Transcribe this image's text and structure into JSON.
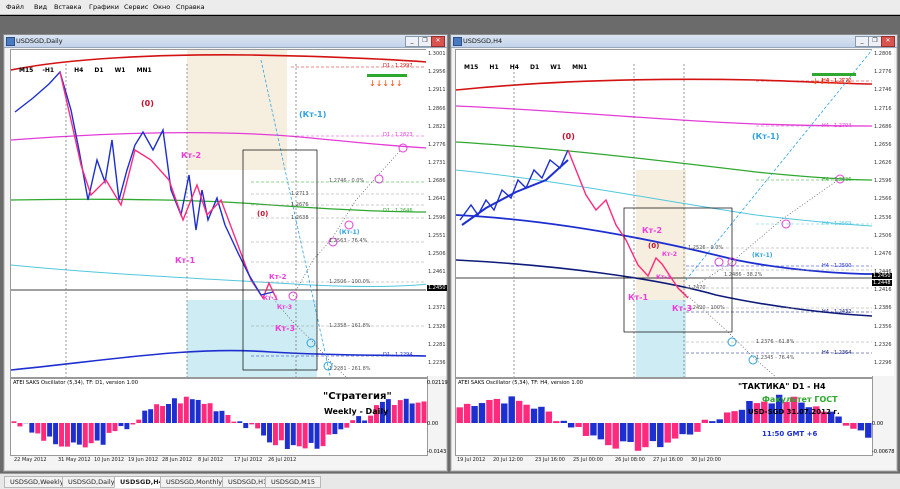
{
  "menu": [
    "Файл",
    "Вид",
    "Вставка",
    "Графики",
    "Сервис",
    "Окно",
    "Справка"
  ],
  "left": {
    "title": "USDSGD,Daily",
    "timeframes": [
      "M15",
      "H1",
      "H4",
      "D1",
      "W1",
      "MN1"
    ],
    "price_scale": [
      "1.3001",
      "1.2956",
      "1.2911",
      "1.2866",
      "1.2821",
      "1.2776",
      "1.2731",
      "1.2686",
      "1.2641",
      "1.2596",
      "1.2551",
      "1.2506",
      "1.2461",
      "1.2416",
      "1.2371",
      "1.2326",
      "1.2281",
      "1.2236"
    ],
    "current_price": "1.2450",
    "top_level": "D1 - 1.2997",
    "level2": "D1 - 1.2823",
    "level3": "D1 - 1.2646",
    "level4": "D1 - 1.2294",
    "fibs": [
      "1.2746 - 0.0%",
      "1.2713",
      "1.2676",
      "1.2638",
      "1.2563 - 76.4%",
      "1.2506 - 100.0%",
      "1.2358 - 161.8%",
      "1.2281 - 261.8%"
    ],
    "labels": {
      "zero": "(0)",
      "kt2": "Кт-2",
      "kt1": "Кт-1",
      "zero2": "(0)",
      "kt1m": "(Кт-1)",
      "kt2b": "Кт-2",
      "kt1b": "Кт-1",
      "kt3": "Кт-3",
      "kt3b": "Кт-3",
      "kt1c": "(Кт-1)"
    },
    "indicator_title": "ATEI SAKS Oscillator (5,34), TF: D1, version 1.00",
    "indicator_scale": [
      "0.02119",
      "0.00",
      "-0.0143"
    ],
    "strategy_title": "\"Стратегия\"",
    "strategy_sub": "Weekly - Daily",
    "xaxis": [
      "22 May 2012",
      "31 May 2012",
      "10 Jun 2012",
      "19 Jun 2012",
      "28 Jun 2012",
      "8 Jul 2012",
      "17 Jul 2012",
      "26 Jul 2012"
    ]
  },
  "right": {
    "title": "USDSGD,H4",
    "timeframes": [
      "M15",
      "H1",
      "H4",
      "D1",
      "W1",
      "MN1"
    ],
    "price_scale": [
      "1.2806",
      "1.2776",
      "1.2746",
      "1.2716",
      "1.2686",
      "1.2656",
      "1.2626",
      "1.2596",
      "1.2566",
      "1.2536",
      "1.2506",
      "1.2476",
      "1.2446",
      "1.2416",
      "1.2386",
      "1.2356",
      "1.2326",
      "1.2296"
    ],
    "current_price": "1.2450",
    "current_price2": "1.2448",
    "top_level": "H4 - 1.2772",
    "level2": "H4 - 1.2704",
    "level3": "H4 - 1.2636",
    "level4": "H4 - 1.2569",
    "level5": "H4 - 1.2500",
    "level6": "H4 - 1.2432",
    "level7": "H4 - 1.2364",
    "fibs": [
      "1.2526 - 0.0%",
      "1.2486 - 38.2%",
      "1.2470",
      "1.2420 - 100%",
      "1.2376 - 61.8%",
      "1.2345 - 76.4%"
    ],
    "labels": {
      "zero": "(0)",
      "kt1m": "(Кт-1)",
      "kt2": "Кт-2",
      "zero2": "(0)",
      "kt2b": "Кт-2",
      "kt1": "Кт-1",
      "kt1b": "Кт-1",
      "kt3": "Кт-3",
      "kt1c": "(Кт-1)"
    },
    "indicator_title": "ATEI SAKS Oscillator (5,34), TF: H4, version 1.00",
    "indicator_scale": [
      "0.00",
      "-0.00678"
    ],
    "tactics_title": "\"ТАКТИКА\"   D1 - H4",
    "faculty": "Факультет ГОСТ",
    "pair_date": "USD-SGD   31.07.2012 г.",
    "time": "11:50   GMT +6",
    "xaxis": [
      "19 Jul 2012",
      "20 Jul 12:00",
      "23 Jul 16:00",
      "25 Jul 00:00",
      "26 Jul 08:00",
      "27 Jul 16:00",
      "30 Jul 20:00"
    ]
  },
  "tabs": [
    "USDSGD,Weekly",
    "USDSGD,Daily",
    "USDSGD,H4",
    "USDSGD,Monthly",
    "USDSGD,H1",
    "USDSGD,M15"
  ],
  "active_tab": "USDSGD,H4",
  "colors": {
    "up": "#1d2fd0",
    "down": "#ff2a7d",
    "red": "#c8102e",
    "green": "#2fa82f",
    "magenta": "#ee3bdc",
    "cyan": "#2fa3e0",
    "navy": "#0d1a7a"
  }
}
